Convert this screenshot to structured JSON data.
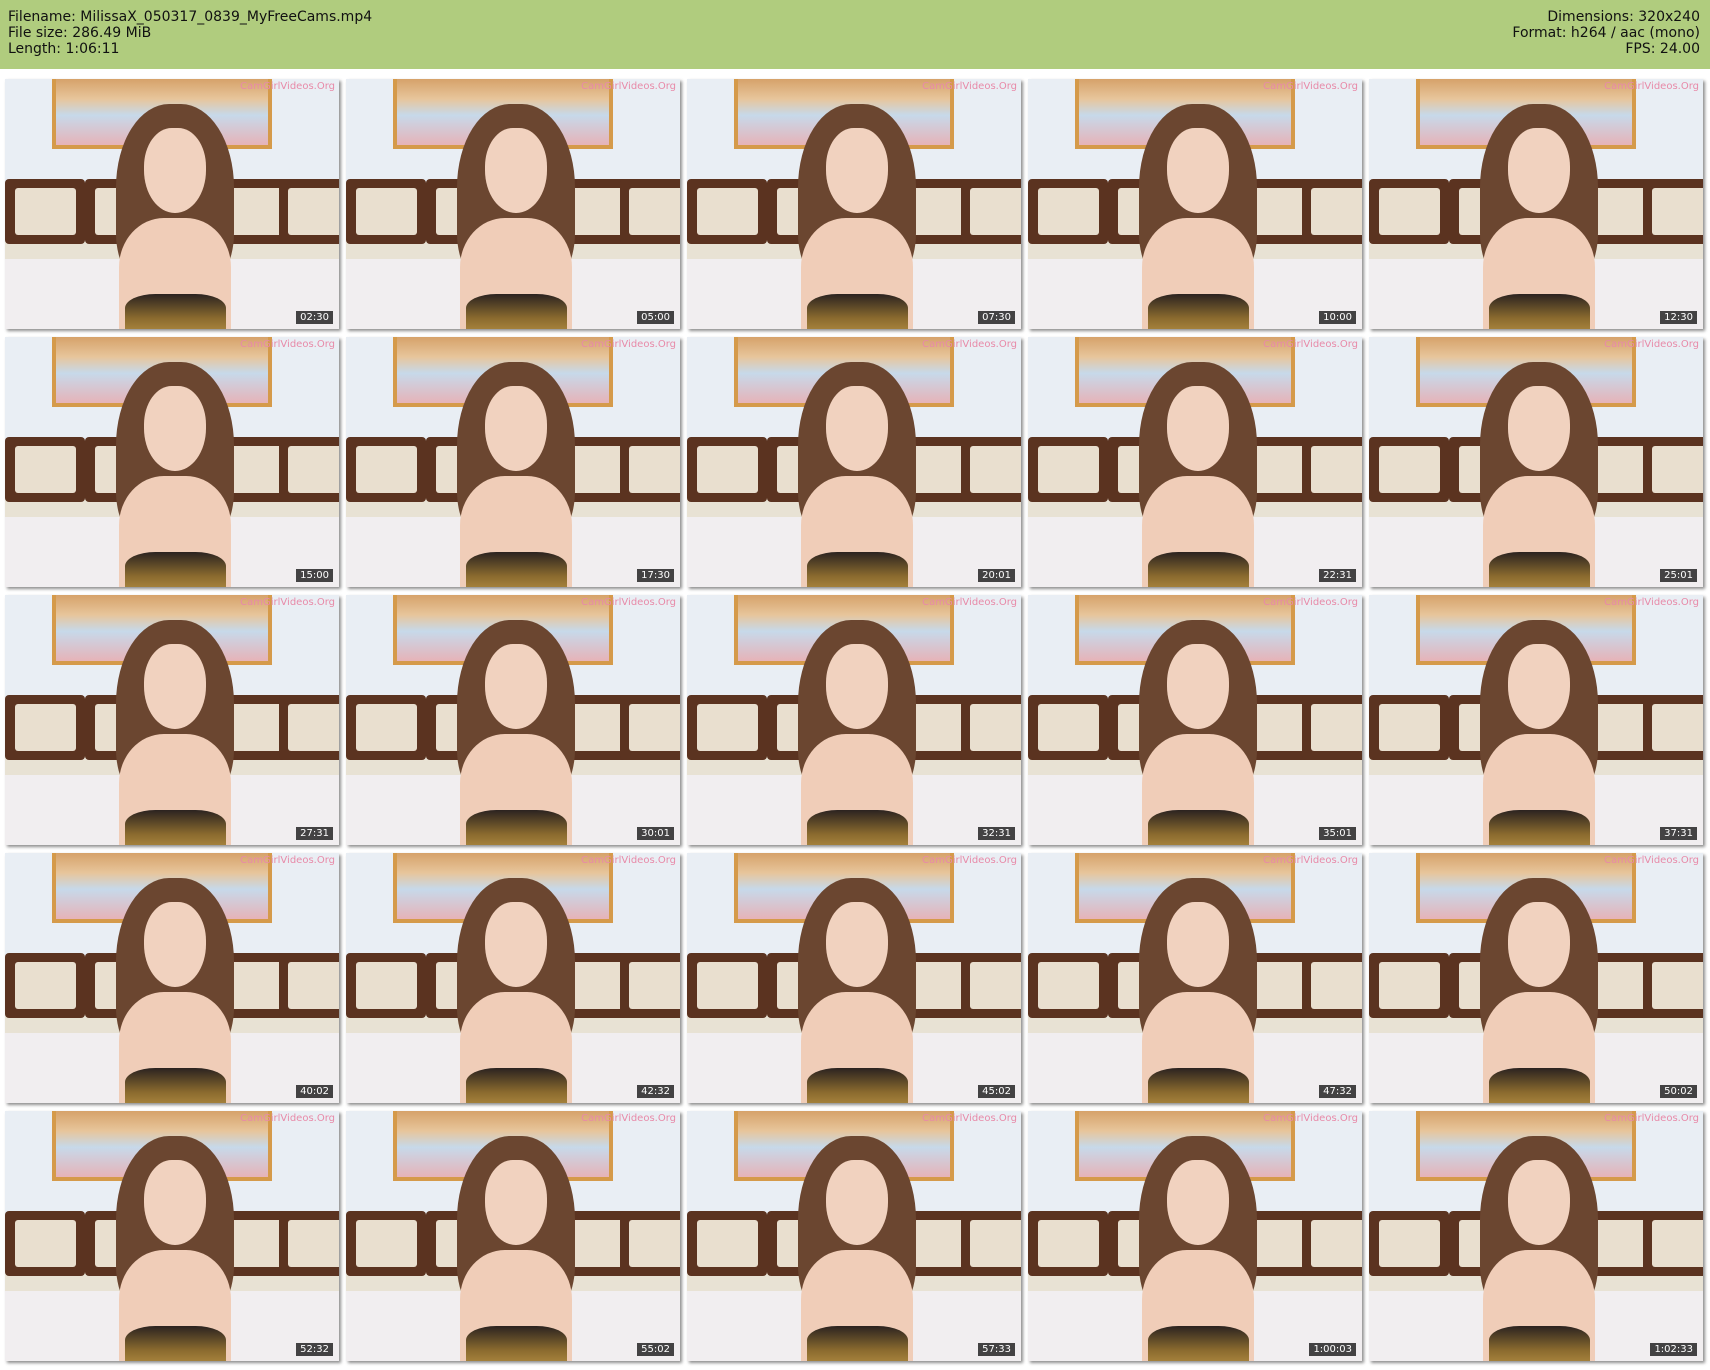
{
  "header": {
    "filename": "Filename: MilissaX_050317_0839_MyFreeCams.mp4",
    "filesize": "File size: 286.49 MiB",
    "length": "Length: 1:06:11",
    "dimensions": "Dimensions: 320x240",
    "format": "Format: h264 / aac (mono)",
    "fps": "FPS: 24.00"
  },
  "watermark": "CamGirlVideos.Org",
  "thumbnails": [
    {
      "timestamp": "02:30"
    },
    {
      "timestamp": "05:00"
    },
    {
      "timestamp": "07:30"
    },
    {
      "timestamp": "10:00"
    },
    {
      "timestamp": "12:30"
    },
    {
      "timestamp": "15:00"
    },
    {
      "timestamp": "17:30"
    },
    {
      "timestamp": "20:01"
    },
    {
      "timestamp": "22:31"
    },
    {
      "timestamp": "25:01"
    },
    {
      "timestamp": "27:31"
    },
    {
      "timestamp": "30:01"
    },
    {
      "timestamp": "32:31"
    },
    {
      "timestamp": "35:01"
    },
    {
      "timestamp": "37:31"
    },
    {
      "timestamp": "40:02"
    },
    {
      "timestamp": "42:32"
    },
    {
      "timestamp": "45:02"
    },
    {
      "timestamp": "47:32"
    },
    {
      "timestamp": "50:02"
    },
    {
      "timestamp": "52:32"
    },
    {
      "timestamp": "55:02"
    },
    {
      "timestamp": "57:33"
    },
    {
      "timestamp": "1:00:03"
    },
    {
      "timestamp": "1:02:33"
    }
  ]
}
